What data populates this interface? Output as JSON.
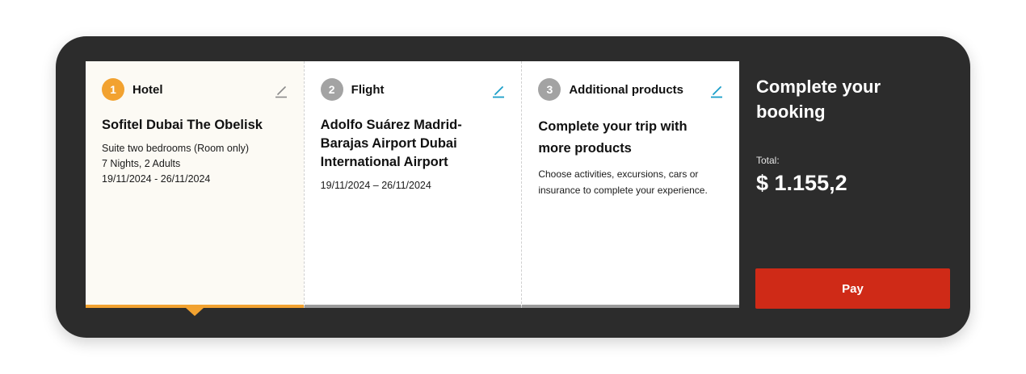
{
  "steps": [
    {
      "number": "1",
      "title": "Hotel",
      "name": "Sofitel Dubai The Obelisk",
      "details": [
        "Suite two bedrooms (Room only)",
        "7 Nights, 2 Adults",
        "19/11/2024 - 26/11/2024"
      ],
      "edit_icon": "pencil-icon",
      "active": true
    },
    {
      "number": "2",
      "title": "Flight",
      "name": "Adolfo Suárez Madrid-\nBarajas Airport  Dubai\nInternational Airport",
      "details": [
        "19/11/2024 – 26/11/2024"
      ],
      "edit_icon": "pencil-icon",
      "active": false
    },
    {
      "number": "3",
      "title": "Additional products",
      "name": "Complete your trip with\nmore products",
      "description": "Choose activities, excursions, cars or insurance to complete your experience.",
      "edit_icon": "pencil-icon",
      "active": false
    }
  ],
  "summary": {
    "title": "Complete your booking",
    "total_label": "Total:",
    "total_value": "$ 1.155,2",
    "pay_label": "Pay"
  },
  "colors": {
    "panel": "#2c2c2c",
    "accent_active": "#f2a230",
    "inactive_step": "#a3a3a3",
    "pay_button": "#cf2a17",
    "edit_active": "#1a9ec9",
    "edit_inactive": "#8a8a8a"
  }
}
